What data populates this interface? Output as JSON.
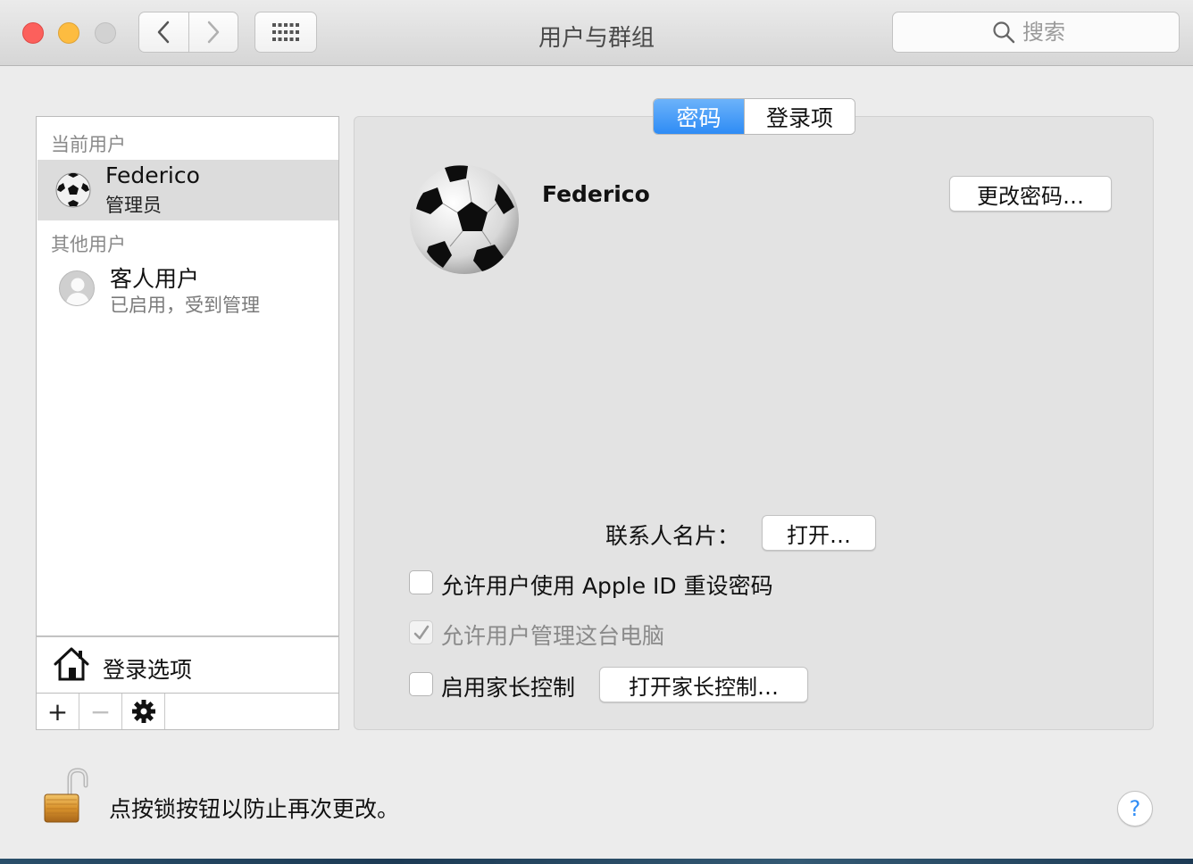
{
  "window": {
    "title": "用户与群组"
  },
  "search": {
    "placeholder": "搜索"
  },
  "sidebar": {
    "current_header": "当前用户",
    "current_user": {
      "name": "Federico",
      "role": "管理员"
    },
    "other_header": "其他用户",
    "other_users": [
      {
        "name": "客人用户",
        "status": "已启用，受到管理"
      }
    ],
    "login_options_label": "登录选项",
    "toolbar": {
      "add": "+",
      "remove": "−"
    }
  },
  "tabs": [
    {
      "label": "密码",
      "active": true
    },
    {
      "label": "登录项",
      "active": false
    }
  ],
  "profile": {
    "name": "Federico",
    "change_password_button": "更改密码…",
    "contact_card_label": "联系人名片：",
    "contact_card_button": "打开…",
    "options": [
      {
        "label": "允许用户使用 Apple ID 重设密码",
        "checked": false,
        "enabled": true
      },
      {
        "label": "允许用户管理这台电脑",
        "checked": true,
        "enabled": false
      },
      {
        "label": "启用家长控制",
        "checked": false,
        "enabled": true
      }
    ],
    "parental_controls_button": "打开家长控制…"
  },
  "footer": {
    "lock_text": "点按锁按钮以防止再次更改。",
    "help": "?"
  },
  "colors": {
    "accent": "#2e8cf5",
    "close": "#fc605c",
    "minimize": "#fdbc40",
    "zoom_disabled": "#d2d2d2"
  }
}
